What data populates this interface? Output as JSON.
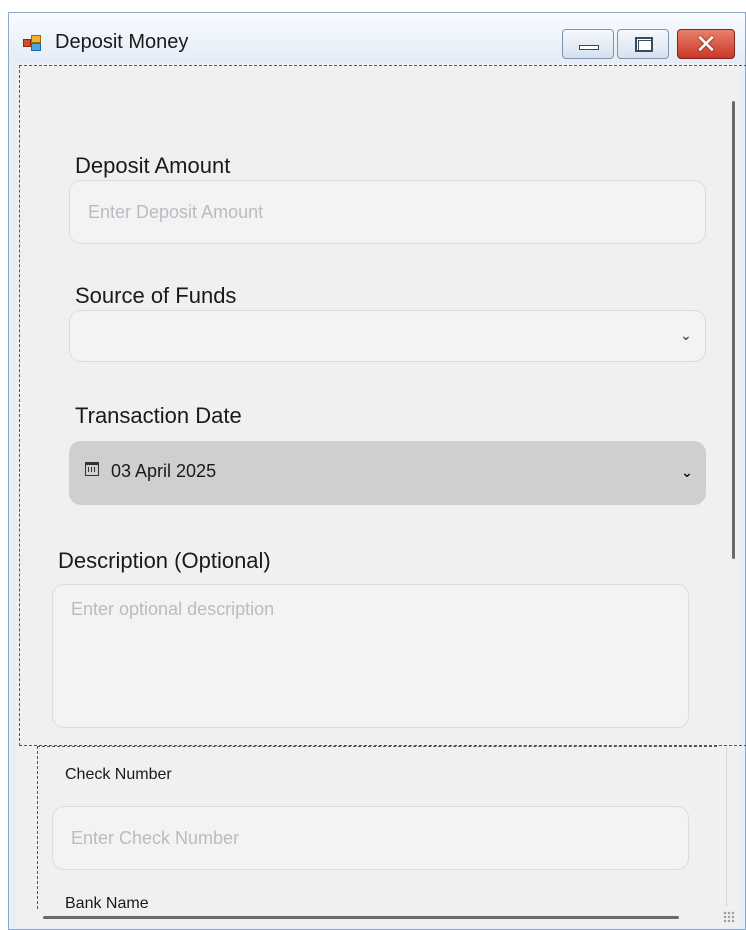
{
  "window": {
    "title": "Deposit Money",
    "close_glyph": "✕"
  },
  "form": {
    "deposit_amount": {
      "label": "Deposit Amount",
      "placeholder": "Enter Deposit Amount",
      "value": ""
    },
    "source_of_funds": {
      "label": "Source of Funds",
      "selected": "",
      "chevron": "⌄"
    },
    "transaction_date": {
      "label": "Transaction Date",
      "value": "03 April 2025",
      "chevron": "⌄",
      "icon": "calendar-icon"
    },
    "description": {
      "label": "Description (Optional)",
      "placeholder": "Enter optional description",
      "value": ""
    },
    "check_number": {
      "label": "Check Number",
      "placeholder": "Enter Check Number",
      "value": ""
    },
    "bank_name": {
      "label": "Bank Name"
    }
  },
  "colors": {
    "client_background": "#f0f0f0",
    "field_background": "#f3f3f3",
    "date_field_background": "#cfcfcf",
    "placeholder": "#b8bcc2"
  }
}
